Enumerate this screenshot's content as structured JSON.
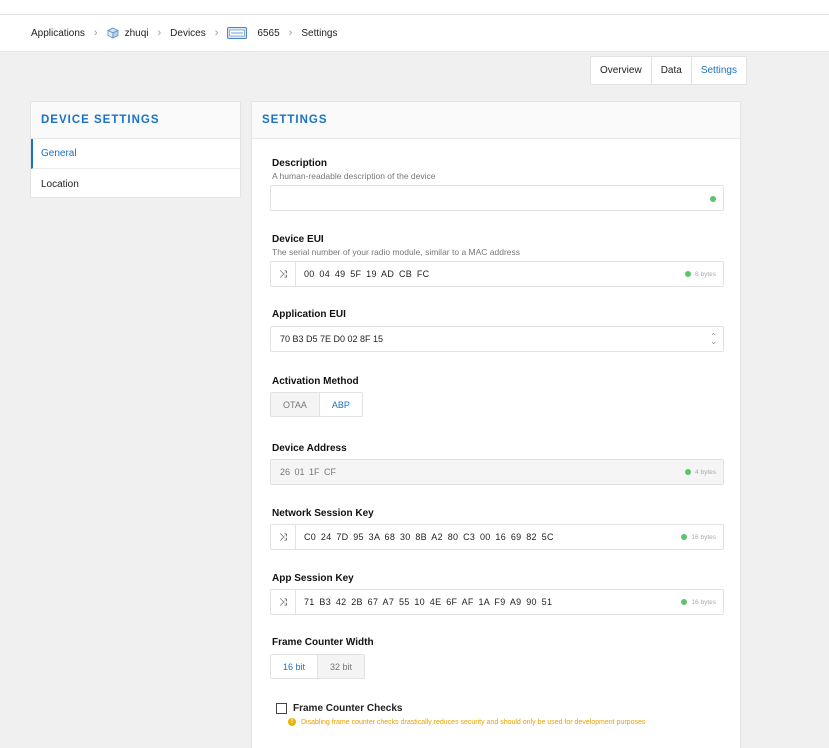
{
  "breadcrumb": {
    "applications": "Applications",
    "app_name": "zhuqi",
    "devices": "Devices",
    "device_id": "6565",
    "settings": "Settings"
  },
  "tabs": [
    {
      "label": "Overview"
    },
    {
      "label": "Data"
    },
    {
      "label": "Settings"
    }
  ],
  "left_card": {
    "title": "DEVICE SETTINGS",
    "items": [
      {
        "label": "General"
      },
      {
        "label": "Location"
      }
    ]
  },
  "main_card": {
    "title": "SETTINGS",
    "description": {
      "label": "Description",
      "hint": "A human-readable description of the device",
      "value": ""
    },
    "device_eui": {
      "label": "Device EUI",
      "hint": "The serial number of your radio module, similar to a MAC address",
      "value": "00 04 49 5F 19 AD CB FC",
      "bytes": "8 bytes"
    },
    "application_eui": {
      "label": "Application EUI",
      "value": "70 B3 D5 7E D0 02 8F 15"
    },
    "activation_method": {
      "label": "Activation Method",
      "options": [
        "OTAA",
        "ABP"
      ],
      "selected": "ABP"
    },
    "device_address": {
      "label": "Device Address",
      "value": "26 01 1F CF",
      "bytes": "4 bytes"
    },
    "network_session_key": {
      "label": "Network Session Key",
      "value": "C0 24 7D 95 3A 68 30 8B A2 80 C3 00 16 69 82 5C",
      "bytes": "16 bytes"
    },
    "app_session_key": {
      "label": "App Session Key",
      "value": "71 B3 42 2B 67 A7 55 10 4E 6F AF 1A F9 A9 90 51",
      "bytes": "16 bytes"
    },
    "frame_counter_width": {
      "label": "Frame Counter Width",
      "options": [
        "16 bit",
        "32 bit"
      ],
      "selected": "16 bit"
    },
    "frame_counter_checks": {
      "label": "Frame Counter Checks",
      "checked": false,
      "warning": "Disabling frame counter checks drastically reduces security and should only be used for development purposes"
    }
  },
  "colors": {
    "accent": "#1a73c2",
    "ok": "#5cc46a",
    "warning": "#e8a000"
  }
}
